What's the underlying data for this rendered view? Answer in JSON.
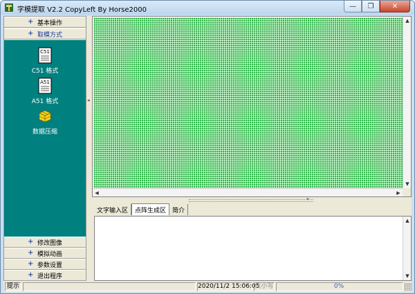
{
  "window": {
    "title": "字模提取 V2.2  CopyLeft By Horse2000",
    "minimize_glyph": "—",
    "restore_glyph": "❐",
    "close_glyph": "✕"
  },
  "sidebar": {
    "top_groups": [
      {
        "label": "基本操作"
      },
      {
        "label": "取模方式"
      }
    ],
    "items": [
      {
        "icon_text": "C51",
        "label": "C51 格式"
      },
      {
        "icon_text": "A51",
        "label": "A51 格式"
      },
      {
        "label": "数据压缩"
      }
    ],
    "bottom_groups": [
      {
        "label": "修改图像"
      },
      {
        "label": "模拟动画"
      },
      {
        "label": "参数设置"
      },
      {
        "label": "退出程序"
      }
    ],
    "plus_glyph": "+"
  },
  "editor": {
    "grid_color": "#2fb34a",
    "tabs": [
      {
        "label": "文字输入区"
      },
      {
        "label": "点阵生成区"
      },
      {
        "label": "简介"
      }
    ],
    "active_tab": "点阵生成区"
  },
  "statusbar": {
    "hint": "提示",
    "datetime": "2020/11/2 15:06:05",
    "caps": "大小写",
    "progress_text": "0%",
    "progress": 0
  }
}
